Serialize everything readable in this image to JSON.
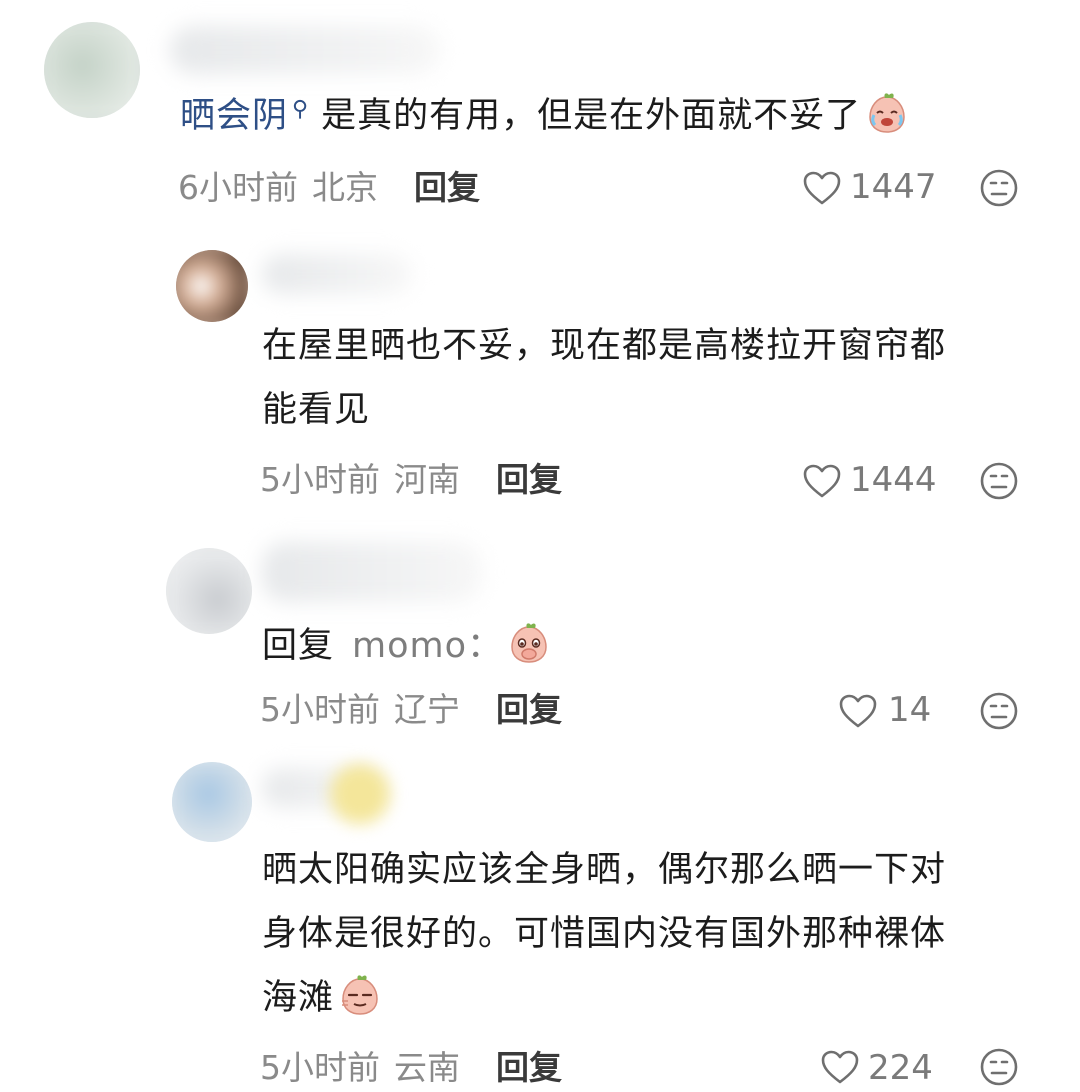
{
  "comments": [
    {
      "mention": "晒会阴",
      "mention_icon": "search-icon",
      "text": "是真的有用，但是在外面就不妥了",
      "emoji": "crying-peach-emoji",
      "time": "6小时前",
      "location": "北京",
      "reply_label": "回复",
      "likes": "1447",
      "icon_like": "heart-icon",
      "icon_dislike": "dislike-face-icon"
    },
    {
      "line1": "在屋里晒也不妥，现在都是高楼拉开窗帘都",
      "line2": "能看见",
      "time": "5小时前",
      "location": "河南",
      "reply_label": "回复",
      "likes": "1444"
    },
    {
      "reply_prefix": "回复",
      "reply_to": "momo：",
      "emoji": "covering-mouth-peach-emoji",
      "time": "5小时前",
      "location": "辽宁",
      "reply_label": "回复",
      "likes": "14"
    },
    {
      "line1": "晒太阳确实应该全身晒，偶尔那么晒一下对",
      "line2": "身体是很好的。可惜国内没有国外那种裸体",
      "line3": "海滩",
      "emoji": "smirk-peach-emoji",
      "time": "5小时前",
      "location": "云南",
      "reply_label": "回复",
      "likes": "224"
    }
  ]
}
